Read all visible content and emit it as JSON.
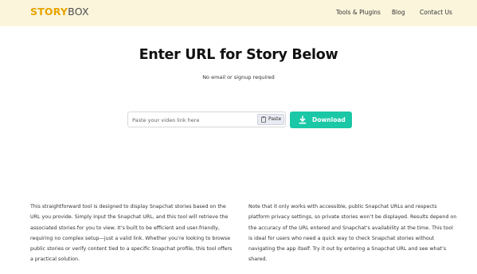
{
  "header": {
    "logo_part1": "STORY",
    "logo_part2": "BOX",
    "nav": [
      "Tools & Plugins",
      "Blog",
      "Contact Us"
    ]
  },
  "main": {
    "title": "Enter URL for Story Below",
    "subtitle": "No email or signup required",
    "url_input": {
      "placeholder": "Paste your video link here",
      "value": ""
    },
    "paste_label": "Paste",
    "download_label": "Download"
  },
  "description": {
    "left": "This straightforward tool is designed to display Snapchat stories based on the URL you provide. Simply input the Snapchat URL, and this tool will retrieve the associated stories for you to view. It’s built to be efficient and user-friendly, requiring no complex setup—just a valid link. Whether you’re looking to browse public stories or verify content tied to a specific Snapchat profile, this tool offers a practical solution.",
    "right": "Note that it only works with accessible, public Snapchat URLs and respects platform privacy settings, so private stories won’t be displayed. Results depend on the accuracy of the URL entered and Snapchat’s availability at the time. This tool is ideal for users who need a quick way to check Snapchat stories without navigating the app itself. Try it out by entering a Snapchat URL and see what’s shared."
  },
  "colors": {
    "header_bg": "#fbf5dc",
    "logo_accent": "#e8a400",
    "download_button": "#1ac7a6"
  },
  "icons": {
    "paste": "clipboard-icon",
    "download": "download-arrow-icon"
  }
}
